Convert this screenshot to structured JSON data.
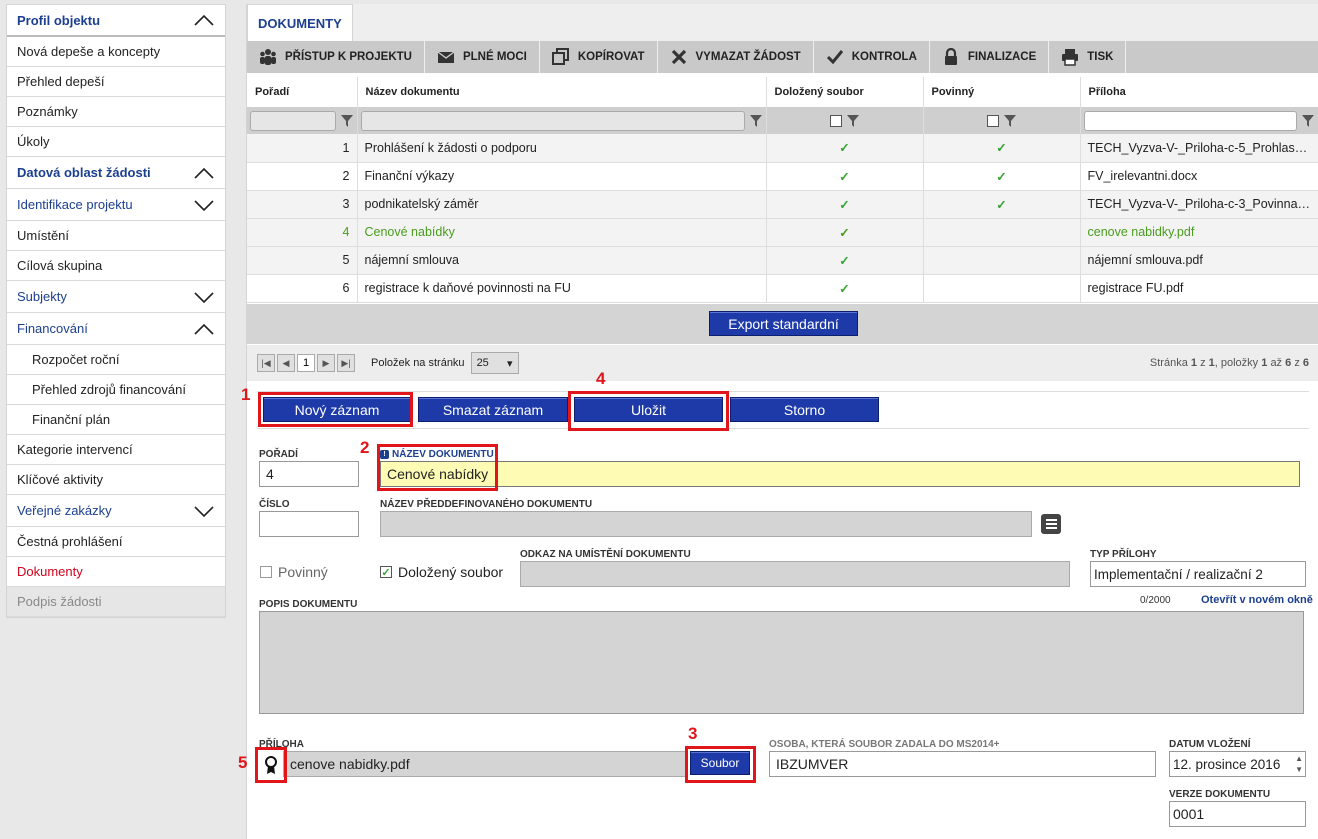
{
  "sidebar": {
    "items": [
      {
        "label": "Profil objektu",
        "type": "head",
        "chev": "up"
      },
      {
        "label": "Nová depeše a koncepty",
        "type": "plain"
      },
      {
        "label": "Přehled depeší",
        "type": "plain"
      },
      {
        "label": "Poznámky",
        "type": "plain"
      },
      {
        "label": "Úkoly",
        "type": "plain"
      },
      {
        "label": "Datová oblast žádosti",
        "type": "head",
        "chev": "up"
      },
      {
        "label": "Identifikace projektu",
        "type": "sect",
        "chev": "down"
      },
      {
        "label": "Umístění",
        "type": "plain"
      },
      {
        "label": "Cílová skupina",
        "type": "plain"
      },
      {
        "label": "Subjekty",
        "type": "sect",
        "chev": "down"
      },
      {
        "label": "Financování",
        "type": "sect",
        "chev": "up"
      },
      {
        "label": "Rozpočet roční",
        "type": "sub"
      },
      {
        "label": "Přehled zdrojů financování",
        "type": "sub"
      },
      {
        "label": "Finanční plán",
        "type": "sub"
      },
      {
        "label": "Kategorie intervencí",
        "type": "plain"
      },
      {
        "label": "Klíčové aktivity",
        "type": "plain"
      },
      {
        "label": "Veřejné zakázky",
        "type": "sect",
        "chev": "down"
      },
      {
        "label": "Čestná prohlášení",
        "type": "plain"
      },
      {
        "label": "Dokumenty",
        "type": "active"
      },
      {
        "label": "Podpis žádosti",
        "type": "dis"
      }
    ]
  },
  "tab": {
    "label": "DOKUMENTY"
  },
  "toolbar": {
    "buttons": [
      {
        "label": "PŘÍSTUP K PROJEKTU",
        "icon": "people-icon"
      },
      {
        "label": "PLNÉ MOCI",
        "icon": "envelope-icon"
      },
      {
        "label": "KOPÍROVAT",
        "icon": "copy-icon"
      },
      {
        "label": "VYMAZAT ŽÁDOST",
        "icon": "x-icon"
      },
      {
        "label": "KONTROLA",
        "icon": "check-icon"
      },
      {
        "label": "FINALIZACE",
        "icon": "lock-icon"
      },
      {
        "label": "TISK",
        "icon": "printer-icon"
      }
    ]
  },
  "grid": {
    "columns": [
      "Pořadí",
      "Název dokumentu",
      "Doložený soubor",
      "Povinný",
      "Příloha"
    ],
    "rows": [
      {
        "no": "1",
        "name": "Prohlášení k žádosti o podporu",
        "doc": true,
        "req": true,
        "att": "TECH_Vyzva-V-_Priloha-c-5_Prohlasen..."
      },
      {
        "no": "2",
        "name": "Finanční výkazy",
        "doc": true,
        "req": true,
        "att": "FV_irelevantni.docx"
      },
      {
        "no": "3",
        "name": "podnikatelský záměr",
        "doc": true,
        "req": true,
        "att": "TECH_Vyzva-V-_Priloha-c-3_Povinna-..."
      },
      {
        "no": "4",
        "name": "Cenové nabídky",
        "doc": true,
        "req": false,
        "att": "cenove nabidky.pdf",
        "selected": true
      },
      {
        "no": "5",
        "name": "nájemní smlouva",
        "doc": true,
        "req": false,
        "att": "nájemní smlouva.pdf"
      },
      {
        "no": "6",
        "name": "registrace k daňové povinnosti na FU",
        "doc": true,
        "req": false,
        "att": "registrace FU.pdf"
      }
    ],
    "check_glyph": "✓",
    "export_label": "Export standardní"
  },
  "pager": {
    "current": "1",
    "per_page_label": "Položek na stránku",
    "per_page": "25",
    "summary_prefix": "Stránka",
    "page": "1",
    "of": "z",
    "pages": "1",
    "items_label": ", položky",
    "from": "1",
    "to_word": "až",
    "to": "6",
    "total": "6"
  },
  "actions": {
    "new": "Nový záznam",
    "delete": "Smazat záznam",
    "save": "Uložit",
    "cancel": "Storno"
  },
  "form": {
    "poradi_label": "POŘADÍ",
    "poradi": "4",
    "nazev_label": "NÁZEV DOKUMENTU",
    "nazev": "Cenové nabídky",
    "cislo_label": "ČÍSLO",
    "cislo": "",
    "predef_label": "NÁZEV PŘEDDEFINOVANÉHO DOKUMENTU",
    "povinny_label": "Povinný",
    "dolozeny_label": "Doložený soubor",
    "odkaz_label": "ODKAZ NA UMÍSTĚNÍ DOKUMENTU",
    "typ_label": "TYP PŘÍLOHY",
    "typ": "Implementační / realizační 2",
    "popis_label": "POPIS DOKUMENTU",
    "popis_count": "0/2000",
    "popis_link": "Otevřít v novém okně",
    "priloha_label": "PŘÍLOHA",
    "priloha": "cenove nabidky.pdf",
    "soubor_btn": "Soubor",
    "osoba_label": "OSOBA, KTERÁ SOUBOR ZADALA DO MS2014+",
    "osoba": "IBZUMVER",
    "datum_label": "DATUM VLOŽENÍ",
    "datum": "12. prosince 2016",
    "verze_label": "VERZE DOKUMENTU",
    "verze": "0001"
  },
  "annotations": [
    "1",
    "2",
    "3",
    "4",
    "5"
  ]
}
